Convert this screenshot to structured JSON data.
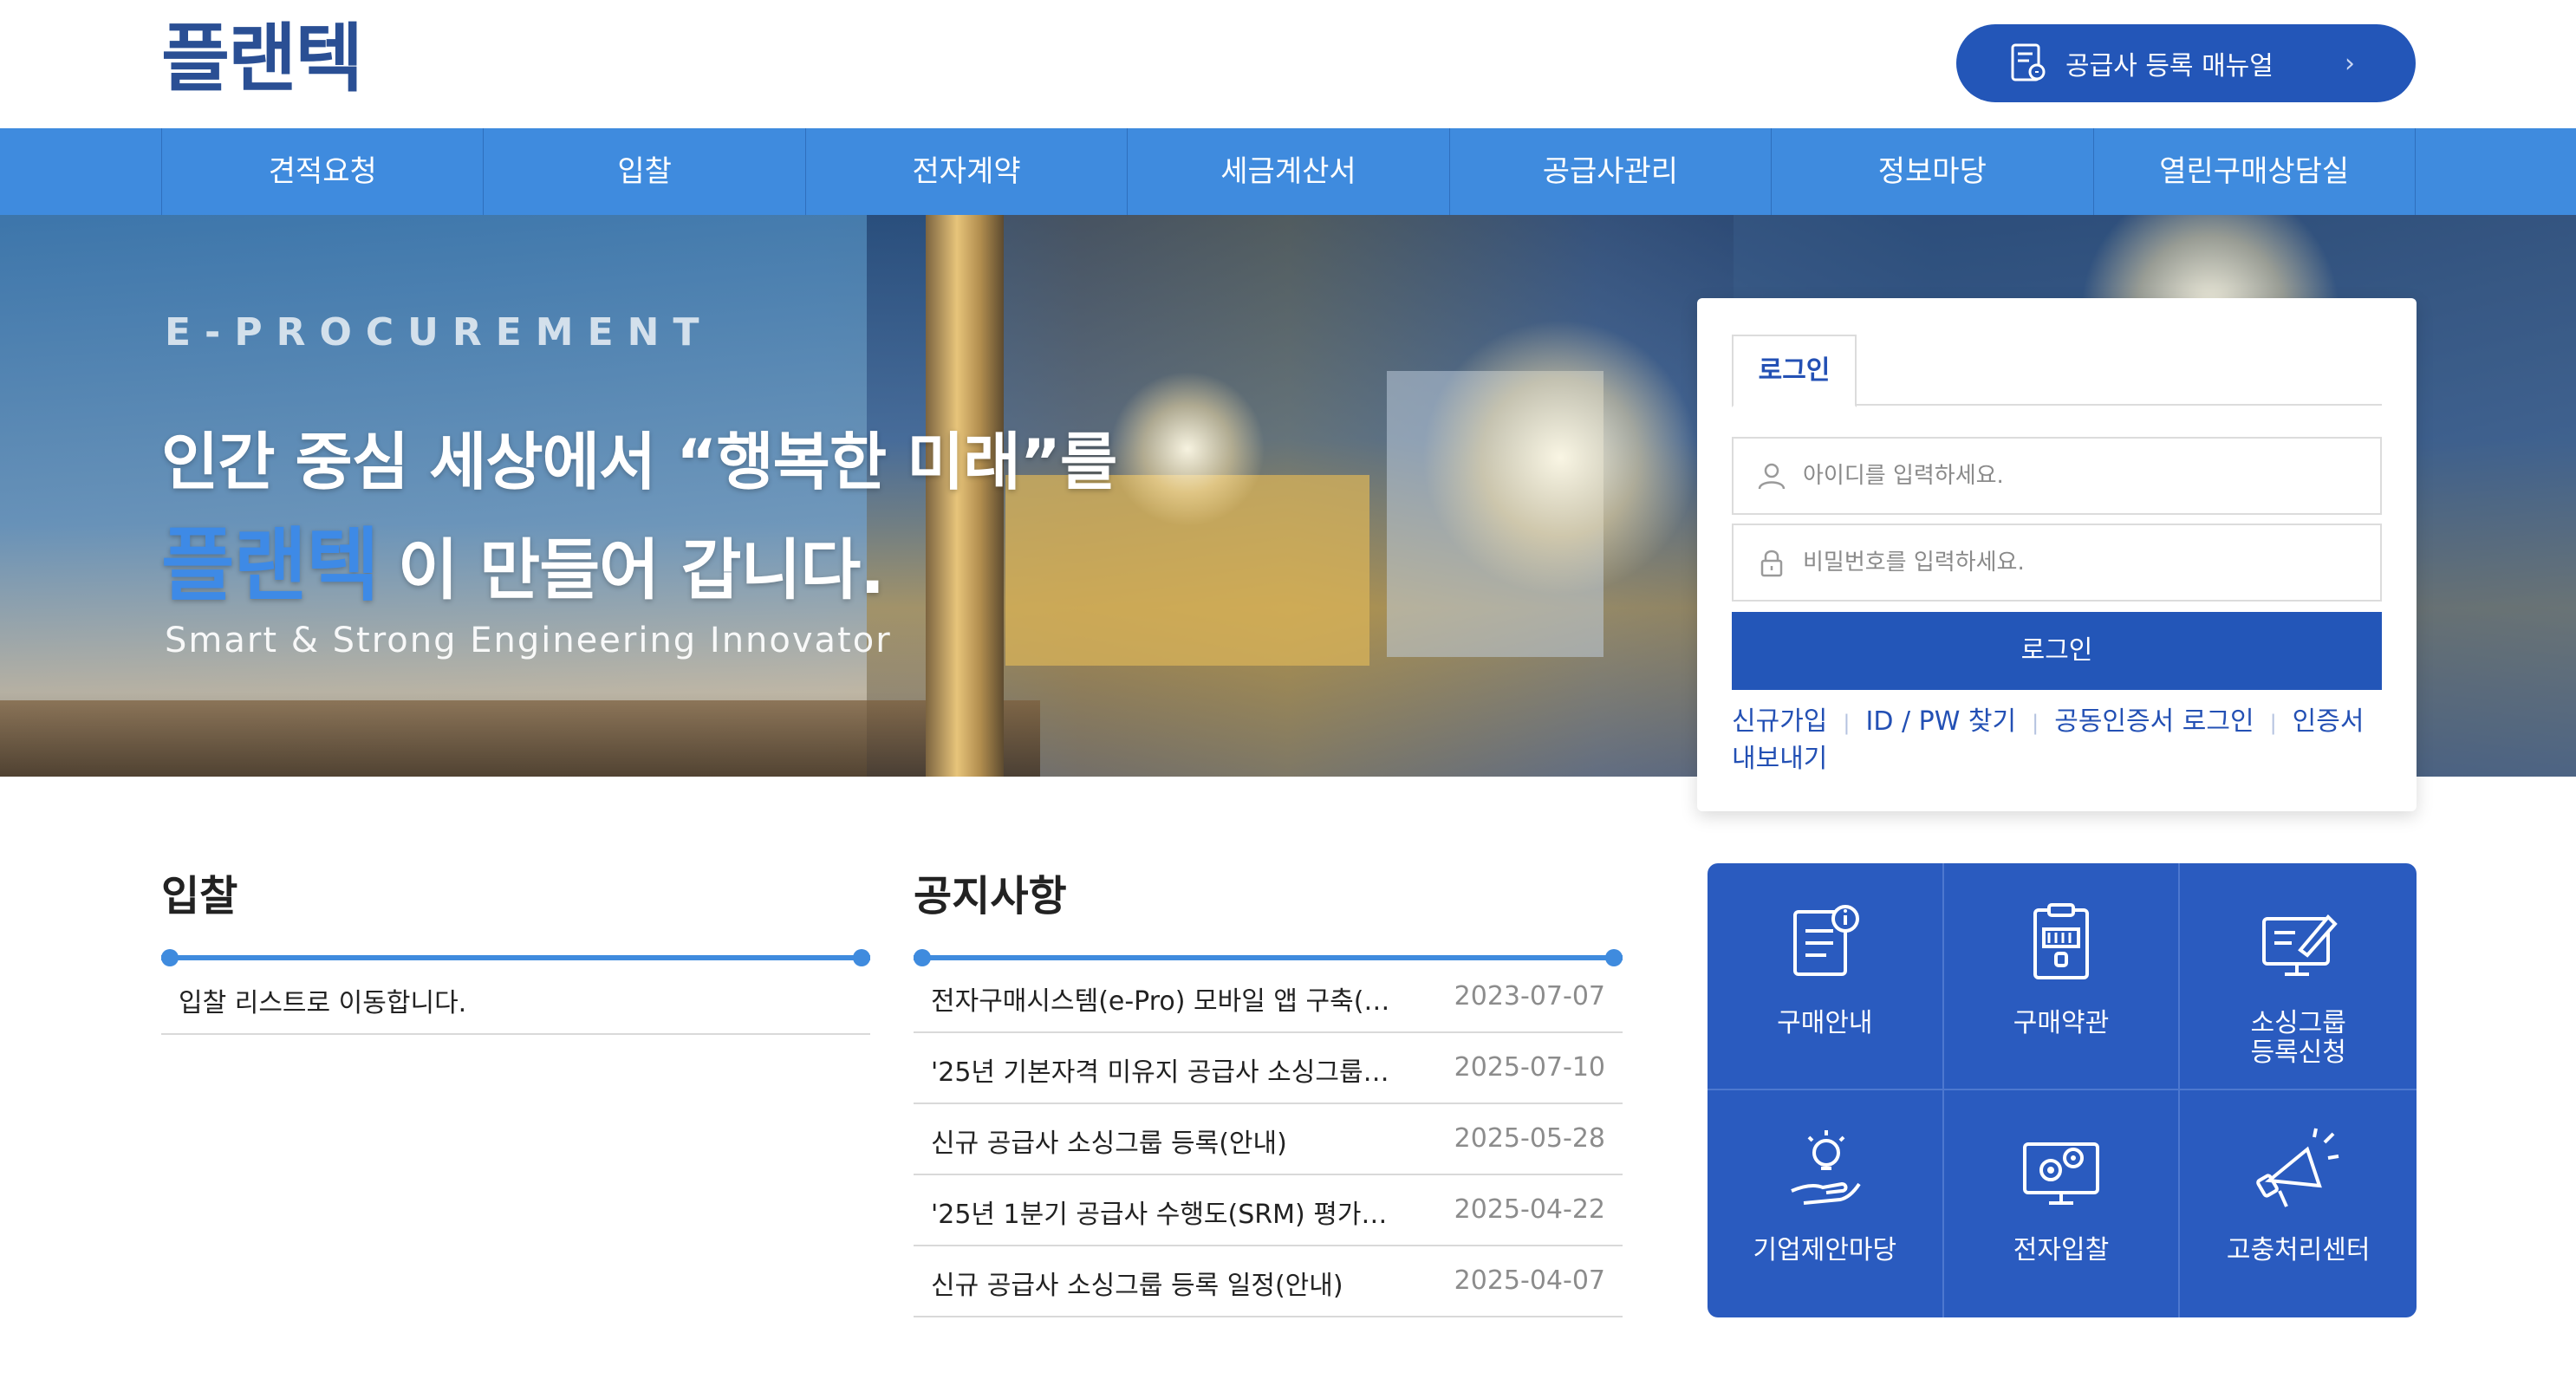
{
  "header": {
    "logo_text": "플랜텍",
    "manual_button": "공급사 등록 매뉴얼",
    "manual_arrow": "›"
  },
  "nav": {
    "items": [
      "견적요청",
      "입찰",
      "전자계약",
      "세금계산서",
      "공급사관리",
      "정보마당",
      "열린구매상담실"
    ]
  },
  "hero": {
    "eng_title": "E-PROCUREMENT",
    "line1": "인간 중심 세상에서 “행복한 미래”를",
    "brand": "플랜텍",
    "line2": "이 만들어 갑니다.",
    "subtitle": "Smart & Strong Engineering Innovator"
  },
  "login": {
    "tab_label": "로그인",
    "id_placeholder": "아이디를 입력하세요.",
    "pw_placeholder": "비밀번호를 입력하세요.",
    "button": "로그인",
    "links": {
      "signup": "신규가입",
      "find": "ID / PW 찾기",
      "cert_login": "공동인증서 로그인",
      "cert_export": "인증서 내보내기"
    }
  },
  "bid": {
    "title": "입찰",
    "message": "입찰 리스트로 이동합니다."
  },
  "notice": {
    "title": "공지사항",
    "items": [
      {
        "title": "전자구매시스템(e-Pro) 모바일 앱 구축(…",
        "date": "2023-07-07"
      },
      {
        "title": "'25년 기본자격 미유지 공급사 소싱그룹…",
        "date": "2025-07-10"
      },
      {
        "title": "신규 공급사 소싱그룹 등록(안내)",
        "date": "2025-05-28"
      },
      {
        "title": "'25년 1분기 공급사 수행도(SRM) 평가…",
        "date": "2025-04-22"
      },
      {
        "title": "신규 공급사 소싱그룹 등록 일정(안내)",
        "date": "2025-04-07"
      }
    ]
  },
  "quick_menu": {
    "items": [
      {
        "label": "구매안내",
        "icon": "document-info-icon"
      },
      {
        "label": "구매약관",
        "icon": "clipboard-contract-icon"
      },
      {
        "label": "소싱그룹\n등록신청",
        "icon": "computer-pen-icon"
      },
      {
        "label": "기업제안마당",
        "icon": "lightbulb-hand-icon"
      },
      {
        "label": "전자입찰",
        "icon": "monitor-gears-icon"
      },
      {
        "label": "고충처리센터",
        "icon": "megaphone-icon"
      }
    ]
  },
  "colors": {
    "brand_blue": "#2356b8",
    "nav_blue": "#3f8bde",
    "quick_blue": "#2a5bbf"
  }
}
